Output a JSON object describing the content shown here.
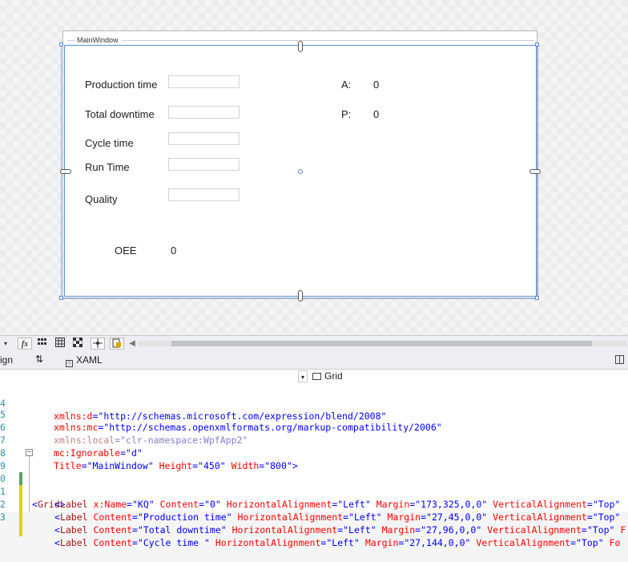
{
  "window": {
    "title": "MainWindow"
  },
  "form": {
    "labels": {
      "production_time": "Production time",
      "total_downtime": "Total downtime",
      "cycle_time": "Cycle time",
      "run_time": "Run Time",
      "quality": "Quality",
      "oee": "OEE",
      "oee_value": "0",
      "a": "A:",
      "a_value": "0",
      "p": "P:",
      "p_value": "0"
    }
  },
  "toolbar": {
    "fx_label": "fx"
  },
  "tabs": {
    "design": "ign",
    "swap": "⇅",
    "xaml": "XAML"
  },
  "nav": {
    "element": "Grid"
  },
  "colors": {
    "selection": "#5b8ed6",
    "xml_string": "#0000ff",
    "xml_attribute": "#ff0000",
    "xml_tag": "#a31515",
    "line_number": "#2b91af"
  },
  "code": {
    "line_numbers": [
      "4",
      "5",
      "6",
      "7",
      "8",
      "9",
      "0",
      "1",
      "2",
      "3"
    ],
    "l4_attr": "xmlns:d",
    "l4_val": "\"http://schemas.microsoft.com/expression/blend/2008\"",
    "l5_attr": "xmlns:mc",
    "l5_val": "\"http://schemas.openxmlformats.org/markup-compatibility/2006\"",
    "l6_attr": "xmlns:local",
    "l6_val": "\"clr-namespace:WpfApp2\"",
    "l7_attr": "mc:Ignorable",
    "l7_val": "\"d\"",
    "l8_attr1": "Title",
    "l8_val1": "\"MainWindow\"",
    "l8_attr2": "Height",
    "l8_val2": "\"450\"",
    "l8_attr3": "Width",
    "l8_val3": "\"800\"",
    "l8_close": ">",
    "l9_open": "<",
    "l9_tag": "Grid",
    "l9_close": ">",
    "l10": {
      "tag": "Label",
      "a1": "x:Name",
      "v1": "\"KQ\"",
      "a2": "Content",
      "v2": "\"0\"",
      "a3": "HorizontalAlignment",
      "v3": "\"Left\"",
      "a4": "Margin",
      "v4": "\"173,325,0,0\"",
      "a5": "VerticalAlignment",
      "v5": "\"Top\""
    },
    "l11": {
      "tag": "Label",
      "a1": "Content",
      "v1": "\"Production time\"",
      "a2": "HorizontalAlignment",
      "v2": "\"Left\"",
      "a3": "Margin",
      "v3": "\"27,45,0,0\"",
      "a4": "VerticalAlignment",
      "v4": "\"Top\""
    },
    "l12": {
      "tag": "Label",
      "a1": "Content",
      "v1": "\"Total downtime\"",
      "a2": "HorizontalAlignment",
      "v2": "\"Left\"",
      "a3": "Margin",
      "v3": "\"27,96,0,0\"",
      "a4": "VerticalAlignment",
      "v4": "\"Top\"",
      "tail": "F"
    },
    "l13": {
      "tag": "Label",
      "a1": "Content",
      "v1": "\"Cycle time \"",
      "a2": "HorizontalAlignment",
      "v2": "\"Left\"",
      "a3": "Margin",
      "v3": "\"27,144,0,0\"",
      "a4": "VerticalAlignment",
      "v4": "\"Top\"",
      "tail": "Fo"
    }
  }
}
